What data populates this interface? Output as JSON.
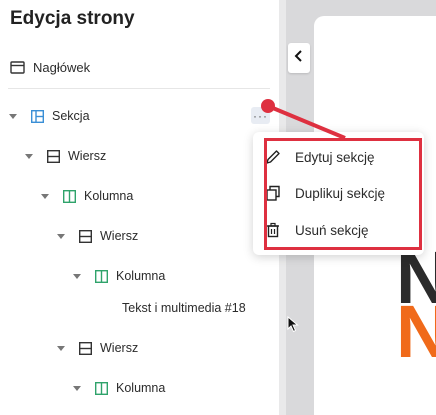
{
  "panel": {
    "title": "Edycja strony",
    "header_item": "Nagłówek"
  },
  "tree": [
    {
      "label": "Sekcja",
      "icon": "section-icon",
      "caret": true
    },
    {
      "label": "Wiersz",
      "icon": "row-icon",
      "caret": true
    },
    {
      "label": "Kolumna",
      "icon": "column-icon",
      "caret": true
    },
    {
      "label": "Wiersz",
      "icon": "row-icon",
      "caret": true
    },
    {
      "label": "Kolumna",
      "icon": "column-icon",
      "caret": true
    },
    {
      "label": "Tekst i multimedia #18",
      "icon": "",
      "caret": false
    },
    {
      "label": "Wiersz",
      "icon": "row-icon",
      "caret": true
    },
    {
      "label": "Kolumna",
      "icon": "column-icon",
      "caret": true
    }
  ],
  "menu": {
    "items": [
      {
        "label": "Edytuj sekcję",
        "icon": "pencil-icon"
      },
      {
        "label": "Duplikuj sekcję",
        "icon": "duplicate-icon"
      },
      {
        "label": "Usuń sekcję",
        "icon": "trash-icon"
      }
    ]
  },
  "more_button": "···",
  "canvas": {
    "letters": [
      {
        "text": "N",
        "color": "#1a1a1a"
      },
      {
        "text": "N",
        "color": "#f06a1a"
      }
    ]
  },
  "colors": {
    "accent_blue": "#3a8fd6",
    "accent_green": "#2fa36b",
    "annotation_red": "#de3040"
  }
}
